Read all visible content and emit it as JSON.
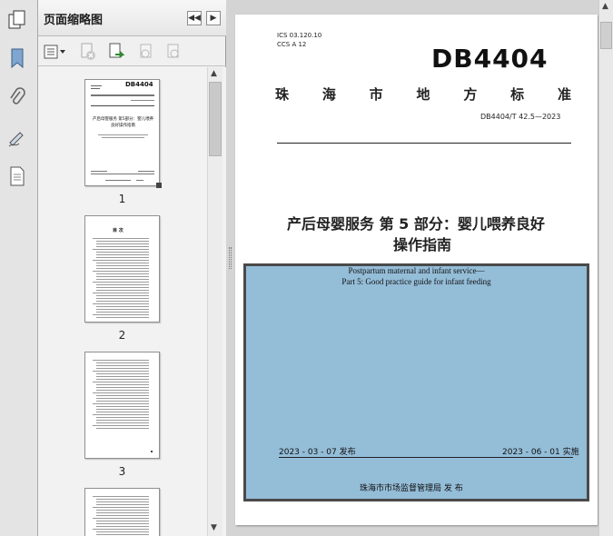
{
  "panel": {
    "title": "页面缩略图"
  },
  "icons": {
    "strip": [
      "pages-icon",
      "bookmark-icon",
      "attachment-icon",
      "signature-icon",
      "layers-icon"
    ],
    "toolbar": [
      "options-menu-icon",
      "delete-page-icon",
      "insert-page-icon",
      "undo-icon",
      "redo-icon"
    ]
  },
  "thumbnails": [
    {
      "number": "1",
      "title_line": "DB4404",
      "main_title": "产后母婴服务 第5部分：婴儿喂养良好操作指南"
    },
    {
      "number": "2",
      "heading": "目 次"
    },
    {
      "number": "3"
    },
    {
      "number": ""
    }
  ],
  "document": {
    "ics": "ICS  03.120.10",
    "ccs": "CCS  A 12",
    "code": "DB4404",
    "region_title": [
      "珠",
      "海",
      "市",
      "地",
      "方",
      "标",
      "准"
    ],
    "standard_no": "DB4404/T 42.5—2023",
    "title_line1": "产后母婴服务 第 5 部分：婴儿喂养良好",
    "title_line2": "操作指南",
    "en_title_line1": "Postpartum maternal and infant service—",
    "en_title_line2": "Part 5: Good practice guide for infant feeding",
    "issue_date": "2023 - 03 - 07 发布",
    "implement_date": "2023 - 06 - 01 实施",
    "publisher": "珠海市市场监督管理局      发  布"
  }
}
